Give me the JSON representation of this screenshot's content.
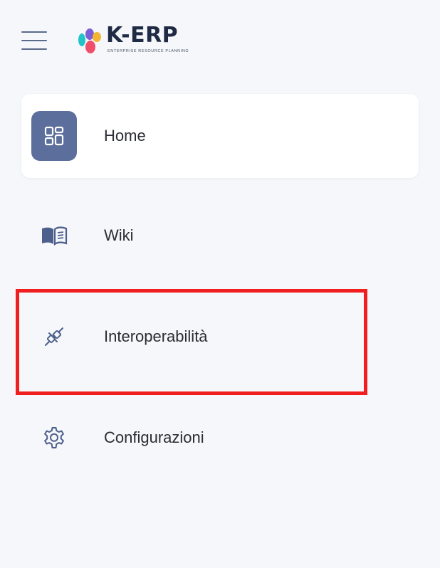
{
  "header": {
    "menu_icon": "hamburger-menu-icon",
    "logo": {
      "name": "K-ERP",
      "tagline": "ENTERPRISE RESOURCE PLANNING"
    }
  },
  "sidebar": {
    "items": [
      {
        "label": "Home",
        "icon": "dashboard-grid-icon",
        "active": true
      },
      {
        "label": "Wiki",
        "icon": "book-icon",
        "active": false
      },
      {
        "label": "Interoperabilità",
        "icon": "plug-connector-icon",
        "active": false,
        "highlighted": true
      },
      {
        "label": "Configurazioni",
        "icon": "gear-icon",
        "active": false
      }
    ]
  },
  "colors": {
    "background": "#f5f7fa",
    "active_item_bg": "#ffffff",
    "active_icon_bg": "#5b6e9c",
    "icon_color": "#4d5f8c",
    "highlight_border": "#f01e1e"
  }
}
